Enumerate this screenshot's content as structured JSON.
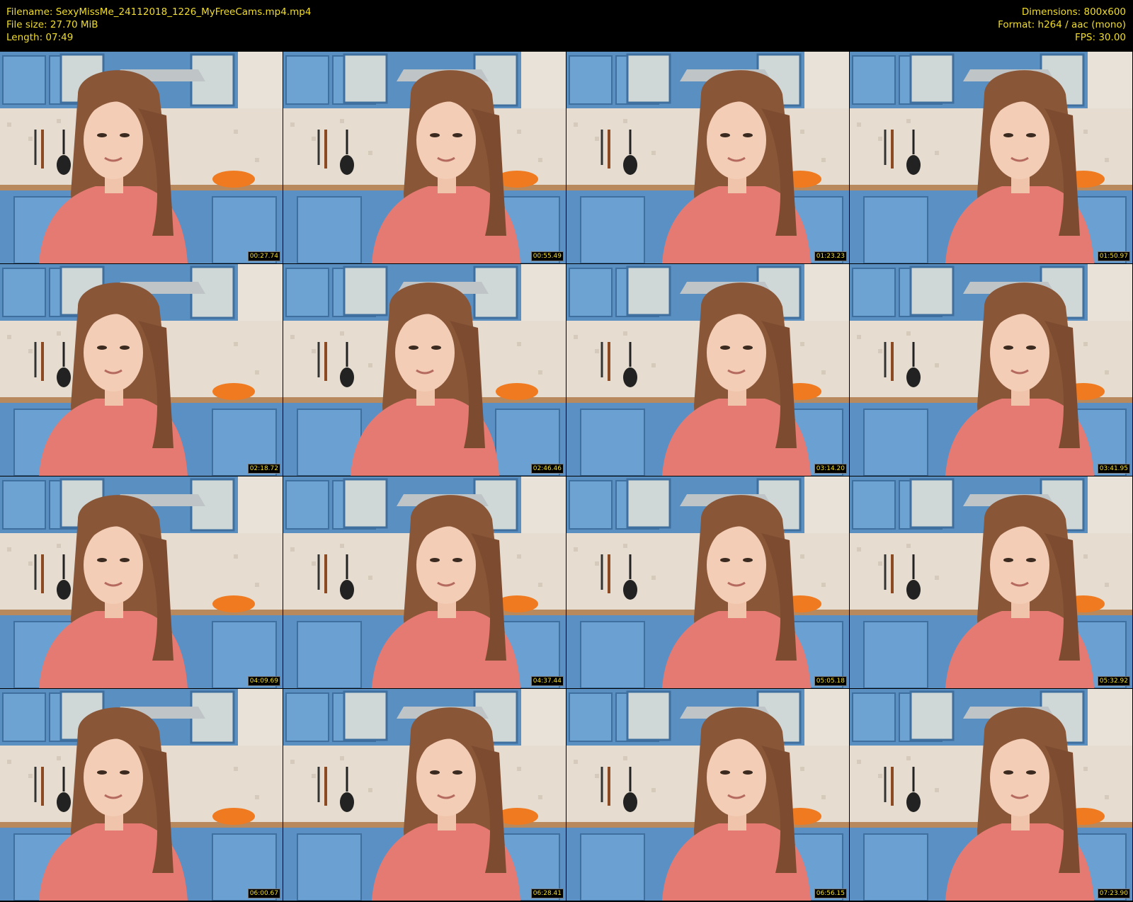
{
  "meta": {
    "filename": "Filename: SexyMissMe_24112018_1226_MyFreeCams.mp4.mp4",
    "filesize": "File size: 27.70 MiB",
    "length": "Length: 07:49",
    "dimensions": "Dimensions: 800x600",
    "format": "Format: h264 / aac (mono)",
    "fps": "FPS: 30.00"
  },
  "colors": {
    "meta_text": "#f2de2a",
    "background": "#000000",
    "cabinet_blue": "#5f95c8",
    "shirt_pink": "#e57a72",
    "hair_brown": "#8a5638"
  },
  "thumbnails": [
    {
      "timestamp": "00:27.74"
    },
    {
      "timestamp": "00:55.49"
    },
    {
      "timestamp": "01:23.23"
    },
    {
      "timestamp": "01:50.97"
    },
    {
      "timestamp": "02:18.72"
    },
    {
      "timestamp": "02:46.46"
    },
    {
      "timestamp": "03:14.20"
    },
    {
      "timestamp": "03:41.95"
    },
    {
      "timestamp": "04:09.69"
    },
    {
      "timestamp": "04:37.44"
    },
    {
      "timestamp": "05:05.18"
    },
    {
      "timestamp": "05:32.92"
    },
    {
      "timestamp": "06:00.67"
    },
    {
      "timestamp": "06:28.41"
    },
    {
      "timestamp": "06:56.15"
    },
    {
      "timestamp": "07:23.90"
    }
  ]
}
